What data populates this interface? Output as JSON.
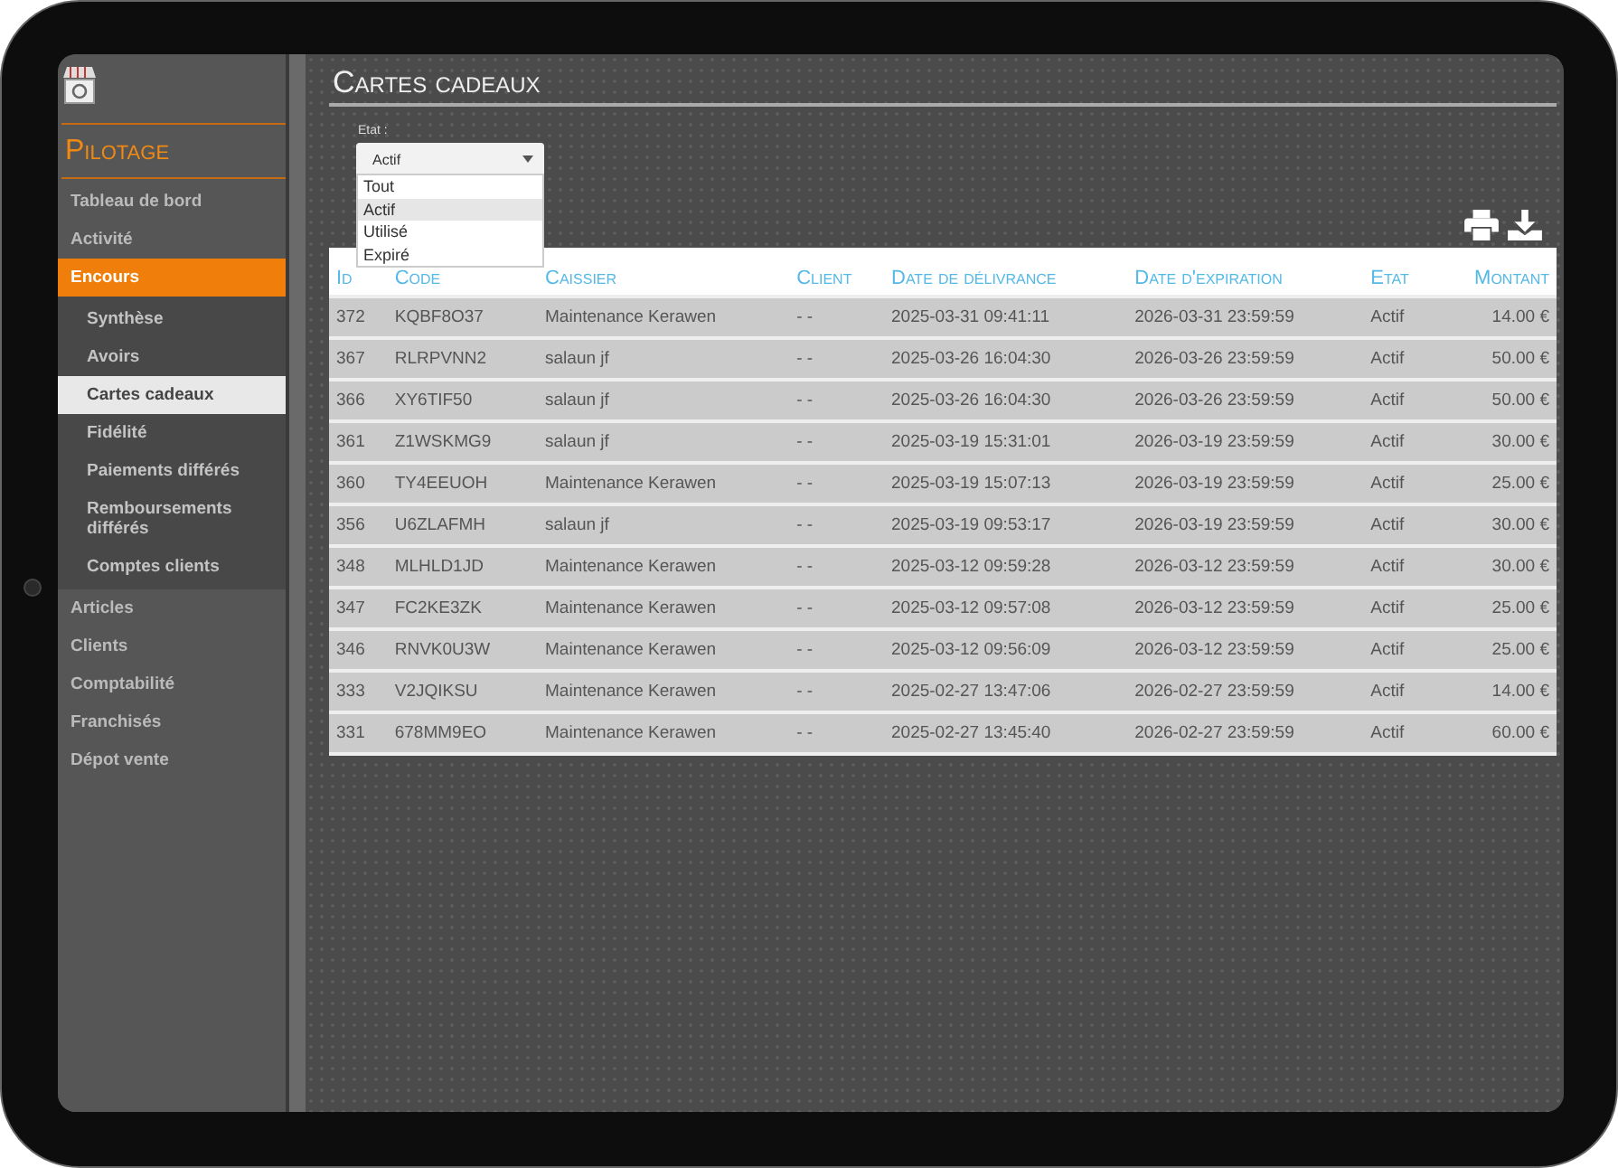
{
  "sidebar": {
    "section_title": "Pilotage",
    "items": [
      {
        "label": "Tableau de bord",
        "selected": false
      },
      {
        "label": "Activité",
        "selected": false
      },
      {
        "label": "Encours",
        "selected": true,
        "expanded": true,
        "children": [
          {
            "label": "Synthèse",
            "selected": false
          },
          {
            "label": "Avoirs",
            "selected": false
          },
          {
            "label": "Cartes cadeaux",
            "selected": true
          },
          {
            "label": "Fidélité",
            "selected": false
          },
          {
            "label": "Paiements différés",
            "selected": false
          },
          {
            "label": "Remboursements différés",
            "selected": false
          },
          {
            "label": "Comptes clients",
            "selected": false
          }
        ]
      },
      {
        "label": "Articles",
        "selected": false
      },
      {
        "label": "Clients",
        "selected": false
      },
      {
        "label": "Comptabilité",
        "selected": false
      },
      {
        "label": "Franchisés",
        "selected": false
      },
      {
        "label": "Dépot vente",
        "selected": false
      }
    ]
  },
  "page_title": "Cartes cadeaux",
  "filter": {
    "label": "Etat :",
    "value": "Actif",
    "expanded": true,
    "options": [
      {
        "label": "Tout",
        "selected": false
      },
      {
        "label": "Actif",
        "selected": true
      },
      {
        "label": "Utilisé",
        "selected": false
      },
      {
        "label": "Expiré",
        "selected": false
      }
    ]
  },
  "table": {
    "columns": [
      "Id",
      "Code",
      "Caissier",
      "Client",
      "Date de délivrance",
      "Date d'expiration",
      "Etat",
      "Montant"
    ],
    "rows": [
      [
        "372",
        "KQBF8O37",
        "Maintenance Kerawen",
        "- -",
        "2025-03-31 09:41:11",
        "2026-03-31 23:59:59",
        "Actif",
        "14.00 €"
      ],
      [
        "367",
        "RLRPVNN2",
        "salaun jf",
        "- -",
        "2025-03-26 16:04:30",
        "2026-03-26 23:59:59",
        "Actif",
        "50.00 €"
      ],
      [
        "366",
        "XY6TIF50",
        "salaun jf",
        "- -",
        "2025-03-26 16:04:30",
        "2026-03-26 23:59:59",
        "Actif",
        "50.00 €"
      ],
      [
        "361",
        "Z1WSKMG9",
        "salaun jf",
        "- -",
        "2025-03-19 15:31:01",
        "2026-03-19 23:59:59",
        "Actif",
        "30.00 €"
      ],
      [
        "360",
        "TY4EEUOH",
        "Maintenance Kerawen",
        "- -",
        "2025-03-19 15:07:13",
        "2026-03-19 23:59:59",
        "Actif",
        "25.00 €"
      ],
      [
        "356",
        "U6ZLAFMH",
        "salaun jf",
        "- -",
        "2025-03-19 09:53:17",
        "2026-03-19 23:59:59",
        "Actif",
        "30.00 €"
      ],
      [
        "348",
        "MLHLD1JD",
        "Maintenance Kerawen",
        "- -",
        "2025-03-12 09:59:28",
        "2026-03-12 23:59:59",
        "Actif",
        "30.00 €"
      ],
      [
        "347",
        "FC2KE3ZK",
        "Maintenance Kerawen",
        "- -",
        "2025-03-12 09:57:08",
        "2026-03-12 23:59:59",
        "Actif",
        "25.00 €"
      ],
      [
        "346",
        "RNVK0U3W",
        "Maintenance Kerawen",
        "- -",
        "2025-03-12 09:56:09",
        "2026-03-12 23:59:59",
        "Actif",
        "25.00 €"
      ],
      [
        "333",
        "V2JQIKSU",
        "Maintenance Kerawen",
        "- -",
        "2025-02-27 13:47:06",
        "2026-02-27 23:59:59",
        "Actif",
        "14.00 €"
      ],
      [
        "331",
        "678MM9EO",
        "Maintenance Kerawen",
        "- -",
        "2025-02-27 13:45:40",
        "2026-02-27 23:59:59",
        "Actif",
        "60.00 €"
      ]
    ]
  }
}
